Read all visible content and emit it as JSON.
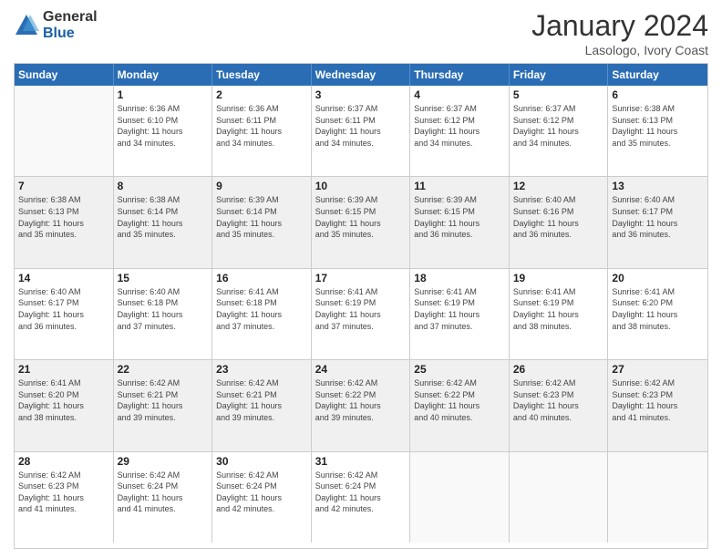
{
  "logo": {
    "general": "General",
    "blue": "Blue"
  },
  "title": "January 2024",
  "subtitle": "Lasologo, Ivory Coast",
  "header_days": [
    "Sunday",
    "Monday",
    "Tuesday",
    "Wednesday",
    "Thursday",
    "Friday",
    "Saturday"
  ],
  "weeks": [
    [
      {
        "day": "",
        "info": ""
      },
      {
        "day": "1",
        "info": "Sunrise: 6:36 AM\nSunset: 6:10 PM\nDaylight: 11 hours\nand 34 minutes."
      },
      {
        "day": "2",
        "info": "Sunrise: 6:36 AM\nSunset: 6:11 PM\nDaylight: 11 hours\nand 34 minutes."
      },
      {
        "day": "3",
        "info": "Sunrise: 6:37 AM\nSunset: 6:11 PM\nDaylight: 11 hours\nand 34 minutes."
      },
      {
        "day": "4",
        "info": "Sunrise: 6:37 AM\nSunset: 6:12 PM\nDaylight: 11 hours\nand 34 minutes."
      },
      {
        "day": "5",
        "info": "Sunrise: 6:37 AM\nSunset: 6:12 PM\nDaylight: 11 hours\nand 34 minutes."
      },
      {
        "day": "6",
        "info": "Sunrise: 6:38 AM\nSunset: 6:13 PM\nDaylight: 11 hours\nand 35 minutes."
      }
    ],
    [
      {
        "day": "7",
        "info": "Sunrise: 6:38 AM\nSunset: 6:13 PM\nDaylight: 11 hours\nand 35 minutes."
      },
      {
        "day": "8",
        "info": "Sunrise: 6:38 AM\nSunset: 6:14 PM\nDaylight: 11 hours\nand 35 minutes."
      },
      {
        "day": "9",
        "info": "Sunrise: 6:39 AM\nSunset: 6:14 PM\nDaylight: 11 hours\nand 35 minutes."
      },
      {
        "day": "10",
        "info": "Sunrise: 6:39 AM\nSunset: 6:15 PM\nDaylight: 11 hours\nand 35 minutes."
      },
      {
        "day": "11",
        "info": "Sunrise: 6:39 AM\nSunset: 6:15 PM\nDaylight: 11 hours\nand 36 minutes."
      },
      {
        "day": "12",
        "info": "Sunrise: 6:40 AM\nSunset: 6:16 PM\nDaylight: 11 hours\nand 36 minutes."
      },
      {
        "day": "13",
        "info": "Sunrise: 6:40 AM\nSunset: 6:17 PM\nDaylight: 11 hours\nand 36 minutes."
      }
    ],
    [
      {
        "day": "14",
        "info": "Sunrise: 6:40 AM\nSunset: 6:17 PM\nDaylight: 11 hours\nand 36 minutes."
      },
      {
        "day": "15",
        "info": "Sunrise: 6:40 AM\nSunset: 6:18 PM\nDaylight: 11 hours\nand 37 minutes."
      },
      {
        "day": "16",
        "info": "Sunrise: 6:41 AM\nSunset: 6:18 PM\nDaylight: 11 hours\nand 37 minutes."
      },
      {
        "day": "17",
        "info": "Sunrise: 6:41 AM\nSunset: 6:19 PM\nDaylight: 11 hours\nand 37 minutes."
      },
      {
        "day": "18",
        "info": "Sunrise: 6:41 AM\nSunset: 6:19 PM\nDaylight: 11 hours\nand 37 minutes."
      },
      {
        "day": "19",
        "info": "Sunrise: 6:41 AM\nSunset: 6:19 PM\nDaylight: 11 hours\nand 38 minutes."
      },
      {
        "day": "20",
        "info": "Sunrise: 6:41 AM\nSunset: 6:20 PM\nDaylight: 11 hours\nand 38 minutes."
      }
    ],
    [
      {
        "day": "21",
        "info": "Sunrise: 6:41 AM\nSunset: 6:20 PM\nDaylight: 11 hours\nand 38 minutes."
      },
      {
        "day": "22",
        "info": "Sunrise: 6:42 AM\nSunset: 6:21 PM\nDaylight: 11 hours\nand 39 minutes."
      },
      {
        "day": "23",
        "info": "Sunrise: 6:42 AM\nSunset: 6:21 PM\nDaylight: 11 hours\nand 39 minutes."
      },
      {
        "day": "24",
        "info": "Sunrise: 6:42 AM\nSunset: 6:22 PM\nDaylight: 11 hours\nand 39 minutes."
      },
      {
        "day": "25",
        "info": "Sunrise: 6:42 AM\nSunset: 6:22 PM\nDaylight: 11 hours\nand 40 minutes."
      },
      {
        "day": "26",
        "info": "Sunrise: 6:42 AM\nSunset: 6:23 PM\nDaylight: 11 hours\nand 40 minutes."
      },
      {
        "day": "27",
        "info": "Sunrise: 6:42 AM\nSunset: 6:23 PM\nDaylight: 11 hours\nand 41 minutes."
      }
    ],
    [
      {
        "day": "28",
        "info": "Sunrise: 6:42 AM\nSunset: 6:23 PM\nDaylight: 11 hours\nand 41 minutes."
      },
      {
        "day": "29",
        "info": "Sunrise: 6:42 AM\nSunset: 6:24 PM\nDaylight: 11 hours\nand 41 minutes."
      },
      {
        "day": "30",
        "info": "Sunrise: 6:42 AM\nSunset: 6:24 PM\nDaylight: 11 hours\nand 42 minutes."
      },
      {
        "day": "31",
        "info": "Sunrise: 6:42 AM\nSunset: 6:24 PM\nDaylight: 11 hours\nand 42 minutes."
      },
      {
        "day": "",
        "info": ""
      },
      {
        "day": "",
        "info": ""
      },
      {
        "day": "",
        "info": ""
      }
    ]
  ]
}
